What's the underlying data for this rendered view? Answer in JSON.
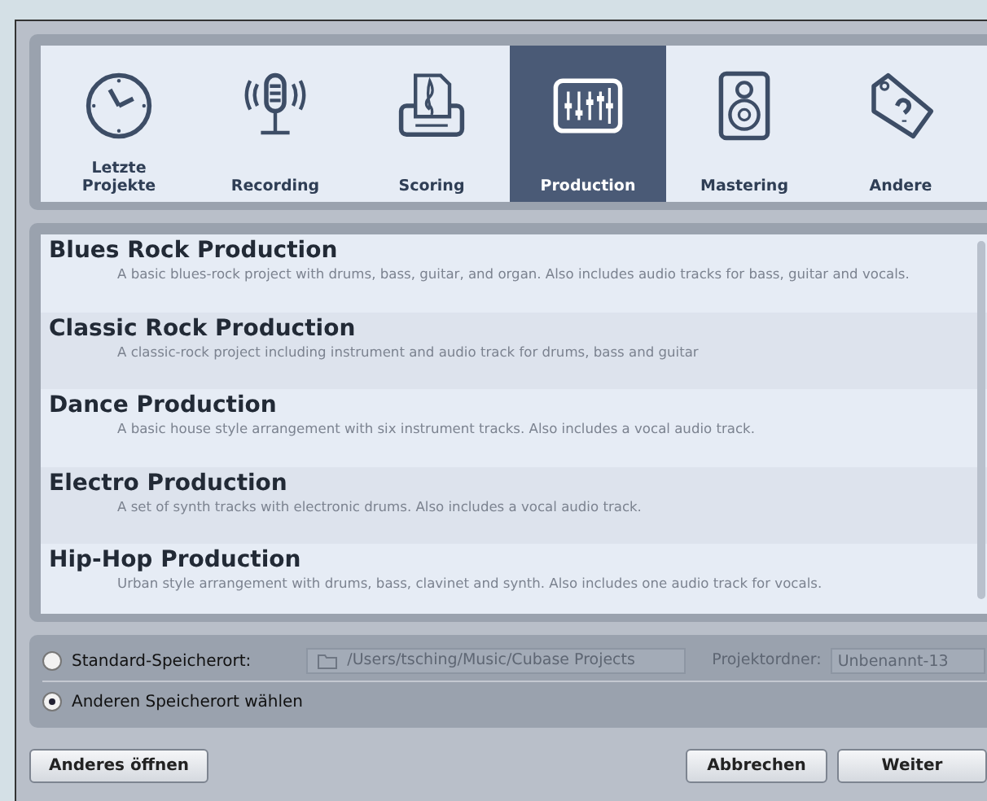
{
  "categories": [
    {
      "label": "Letzte Projekte",
      "kind": "clock",
      "selected": false
    },
    {
      "label": "Recording",
      "kind": "microphone",
      "selected": false
    },
    {
      "label": "Scoring",
      "kind": "score",
      "selected": false
    },
    {
      "label": "Production",
      "kind": "mixer",
      "selected": true
    },
    {
      "label": "Mastering",
      "kind": "speaker",
      "selected": false
    },
    {
      "label": "Andere",
      "kind": "tag",
      "selected": false
    }
  ],
  "templates": [
    {
      "title": "Blues Rock Production",
      "description": "A basic blues-rock project with drums, bass, guitar, and organ. Also includes audio tracks for bass, guitar and vocals."
    },
    {
      "title": "Classic Rock Production",
      "description": "A classic-rock project including instrument and audio track for drums, bass and guitar"
    },
    {
      "title": "Dance Production",
      "description": "A basic house style arrangement with six instrument tracks. Also includes a vocal audio track."
    },
    {
      "title": "Electro Production",
      "description": "A set of synth tracks with electronic drums. Also includes a vocal audio track."
    },
    {
      "title": "Hip-Hop Production",
      "description": "Urban style arrangement with drums, bass, clavinet and synth. Also includes one audio track for vocals."
    }
  ],
  "location": {
    "options": [
      {
        "label": "Standard-Speicherort:",
        "selected": false
      },
      {
        "label": "Anderen Speicherort wählen",
        "selected": true
      }
    ],
    "path": "/Users/tsching/Music/Cubase Projects",
    "folder_label": "Projektordner:",
    "folder": "Unbenannt-13"
  },
  "buttons": {
    "left": "Anderes öffnen",
    "cancel": "Abbrechen",
    "next": "Weiter"
  }
}
